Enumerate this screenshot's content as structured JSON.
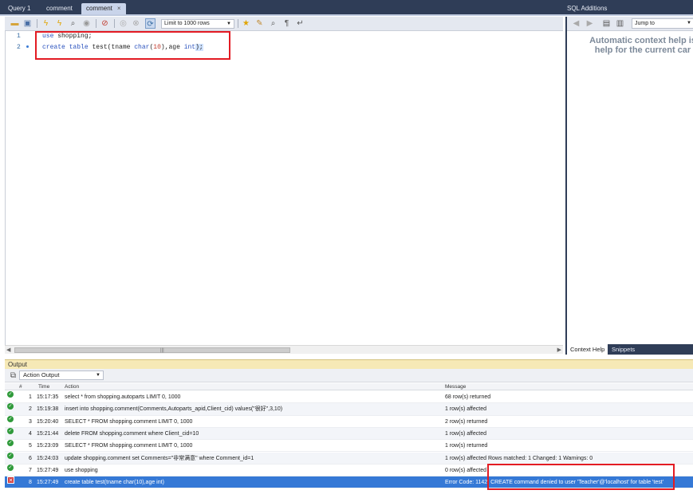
{
  "tabs": [
    {
      "label": "Query 1"
    },
    {
      "label": "comment"
    },
    {
      "label": "comment",
      "close": "×"
    }
  ],
  "sql_additions": {
    "title": "SQL Additions",
    "jump_to": "Jump to",
    "help_text": "Automatic context help is\nhelp for the current car",
    "tabs": [
      "Context Help",
      "Snippets"
    ]
  },
  "toolbar": {
    "limit_value": "Limit to 1000 rows",
    "icons": [
      "open-folder-icon",
      "save-icon",
      "execute-icon",
      "execute-current-icon",
      "explain-icon",
      "stop-icon",
      "toggle-error-icon",
      "commit-icon",
      "rollback-icon",
      "autocommit-icon",
      "limit-icon",
      "beautify-icon",
      "find-icon",
      "invisibles-icon",
      "wrap-icon"
    ]
  },
  "editor": {
    "lines": [
      {
        "num": "1",
        "tokens": [
          {
            "t": "use",
            "c": "kw"
          },
          {
            "t": " shopping;",
            "c": ""
          }
        ]
      },
      {
        "num": "2",
        "tokens": [
          {
            "t": "create",
            "c": "kw"
          },
          {
            "t": " ",
            "c": ""
          },
          {
            "t": "table",
            "c": "kw"
          },
          {
            "t": " test(tname ",
            "c": ""
          },
          {
            "t": "char",
            "c": "kw"
          },
          {
            "t": "(",
            "c": ""
          },
          {
            "t": "10",
            "c": "num"
          },
          {
            "t": "),age ",
            "c": ""
          },
          {
            "t": "int",
            "c": "kw"
          },
          {
            "t": ");",
            "c": "sel"
          }
        ]
      }
    ]
  },
  "output": {
    "title": "Output",
    "action_select": "Action Output",
    "columns": {
      "num": "#",
      "time": "Time",
      "action": "Action",
      "message": "Message"
    },
    "rows": [
      {
        "status": "ok",
        "num": "1",
        "time": "15:17:35",
        "action": "select * from shopping.autoparts LIMIT 0, 1000",
        "message": "68 row(s) returned"
      },
      {
        "status": "ok",
        "num": "2",
        "time": "15:19:38",
        "action": "insert into shopping.comment(Comments,Autoparts_apid,Client_cid) values(\"很好\",3,10)",
        "message": "1 row(s) affected"
      },
      {
        "status": "ok",
        "num": "3",
        "time": "15:20:40",
        "action": "SELECT * FROM shopping.comment LIMIT 0, 1000",
        "message": "2 row(s) returned"
      },
      {
        "status": "ok",
        "num": "4",
        "time": "15:21:44",
        "action": "delete FROM shopping.comment where Client_cid=10",
        "message": "1 row(s) affected"
      },
      {
        "status": "ok",
        "num": "5",
        "time": "15:23:09",
        "action": "SELECT * FROM shopping.comment LIMIT 0, 1000",
        "message": "1 row(s) returned"
      },
      {
        "status": "ok",
        "num": "6",
        "time": "15:24:03",
        "action": "update shopping.comment set Comments=\"非常满意\" where Comment_id=1",
        "message": "1 row(s) affected Rows matched: 1  Changed: 1  Warnings: 0"
      },
      {
        "status": "ok",
        "num": "7",
        "time": "15:27:49",
        "action": "use shopping",
        "message": "0 row(s) affected"
      },
      {
        "status": "error",
        "num": "8",
        "time": "15:27:49",
        "action": "create table test(tname char(10),age int)",
        "message": "Error Code: 1142. CREATE command denied to user 'Teacher'@'localhost' for table 'test'"
      }
    ]
  },
  "colors": {
    "accent": "#2f3d57",
    "error_row": "#3579d6",
    "highlight": "#e31b23"
  }
}
